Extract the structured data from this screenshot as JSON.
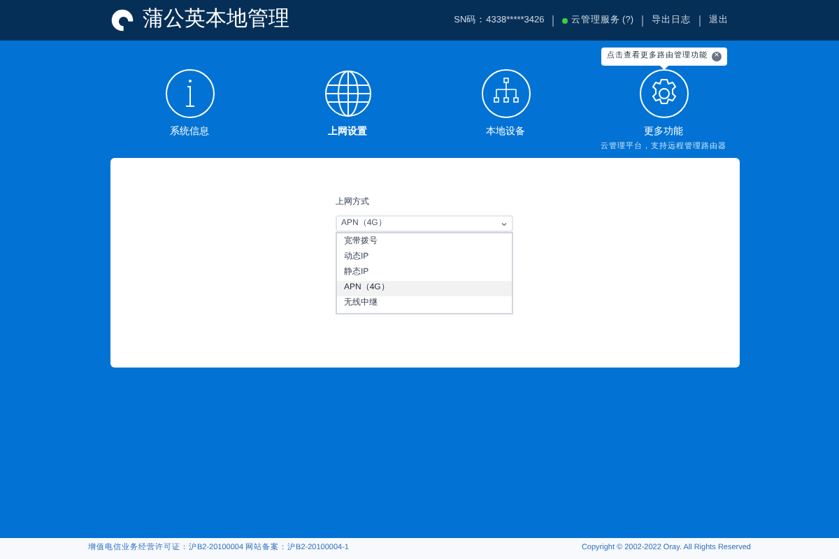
{
  "header": {
    "brand": "蒲公英本地管理",
    "sn": "SN码：4338*****3426",
    "cloud_service": {
      "label": "云管理服务 (?)",
      "online": true
    },
    "links": [
      "导出日志",
      "退出"
    ]
  },
  "tooltip": {
    "text": "点击查看更多路由管理功能",
    "close": "×"
  },
  "nav": [
    {
      "kind": "info",
      "label": "系统信息",
      "selected": false
    },
    {
      "kind": "globe",
      "label": "上网设置",
      "selected": true
    },
    {
      "kind": "devices",
      "label": "本地设备",
      "selected": false
    },
    {
      "kind": "gear",
      "label": "更多功能",
      "sublabel": "云管理平台，支持远程管理路由器",
      "selected": false
    }
  ],
  "form": {
    "label": "上网方式",
    "value": "APN（4G）",
    "options": [
      {
        "label": "宽带拨号",
        "selected": false
      },
      {
        "label": "动态IP",
        "selected": false
      },
      {
        "label": "静态IP",
        "selected": false
      },
      {
        "label": "APN（4G）",
        "selected": true
      },
      {
        "label": "无线中继",
        "selected": false
      }
    ]
  },
  "footer": {
    "license": "增值电信业务经营许可证：沪B2-20100004 网站备案：沪B2-20100004-1",
    "copyright": "Copyright © 2002-2022 Oray. All Rights Reserved"
  }
}
